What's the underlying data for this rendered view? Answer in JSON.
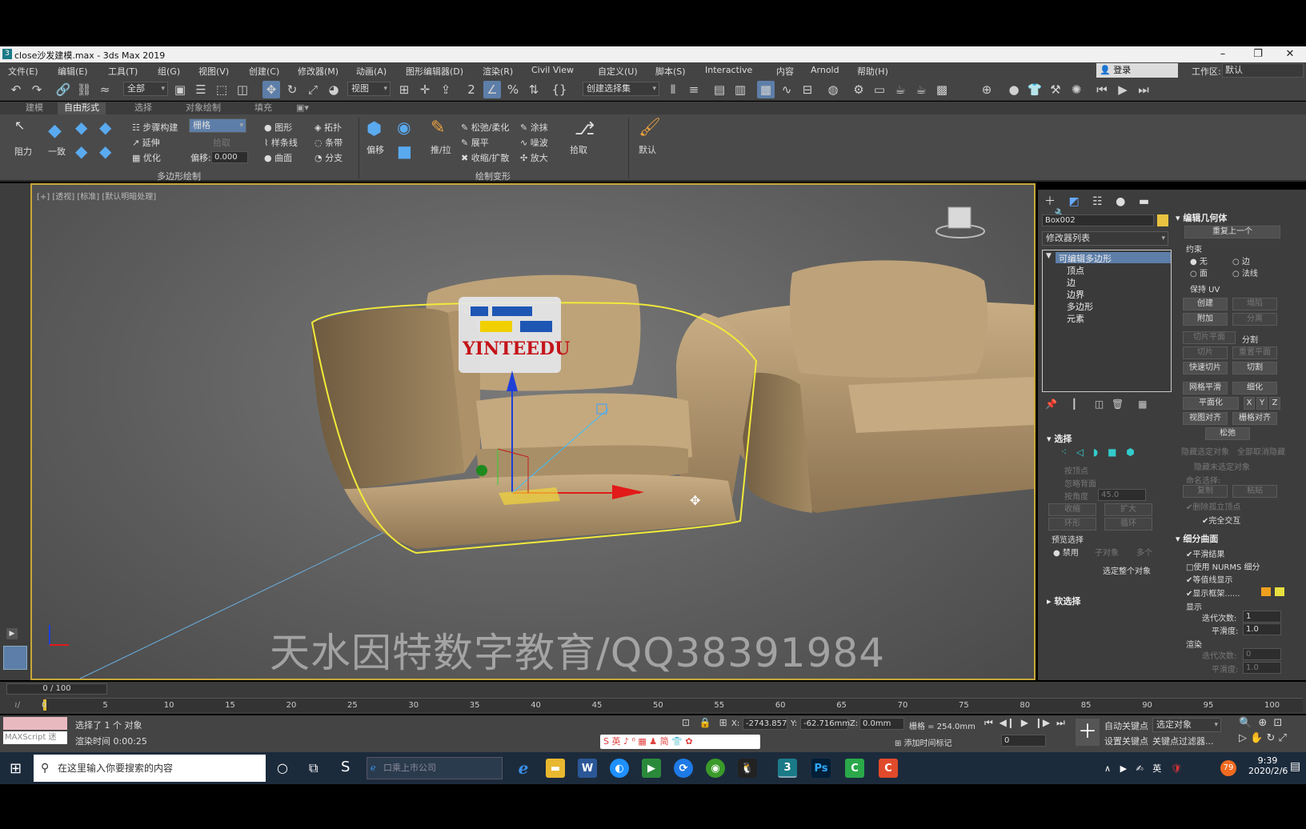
{
  "window": {
    "title": "close沙发建模.max - 3ds Max 2019",
    "app_logo": "3",
    "min": "–",
    "restore": "❐",
    "close": "✕"
  },
  "menu": {
    "items": [
      "文件(E)",
      "编辑(E)",
      "工具(T)",
      "组(G)",
      "视图(V)",
      "创建(C)",
      "修改器(M)",
      "动画(A)",
      "图形编辑器(D)",
      "渲染(R)",
      "Civil View",
      "自定义(U)",
      "脚本(S)",
      "Interactive",
      "内容",
      "Arnold",
      "帮助(H)"
    ],
    "login": "登录",
    "workspace_label": "工作区:",
    "workspace_value": "默认"
  },
  "toolbar": {
    "filter": "全部",
    "view_ref": "视图",
    "selection_set": "创建选择集"
  },
  "ribbon": {
    "tabs": [
      "建模",
      "自由形式",
      "选择",
      "对象绘制",
      "填充"
    ],
    "active_tab": "自由形式",
    "groups": {
      "poly_draw": "多边形绘制",
      "paint_deform": "绘制变形"
    },
    "labels": {
      "drag": "阻力",
      "conform": "一致",
      "step_build": "步骤构建",
      "extend": "延伸",
      "optimize": "优化",
      "grid_dd": "栅格",
      "pick": "拾取",
      "offset_label": "偏移:",
      "offset_value": "0.000",
      "shapes": "图形",
      "splines": "样条线",
      "surface": "曲面",
      "topology": "拓扑",
      "strips": "条带",
      "branches": "分支",
      "shift": "偏移",
      "push_pull": "推/拉",
      "relax_soft": "松弛/柔化",
      "flatten": "展平",
      "pinch_spread": "收缩/扩散",
      "smudge": "涂抹",
      "noise": "噪波",
      "exaggerate": "放大",
      "pickup": "拾取",
      "default": "默认"
    }
  },
  "viewport": {
    "label": "[+] [透视] [标准] [默认明暗处理]",
    "logo_text": "YINTEEDU",
    "watermark": "天水因特数字教育/QQ38391984"
  },
  "command_panel": {
    "object_name": "Box002",
    "object_color": "#e8c240",
    "modifier_list": "修改器列表",
    "stack": [
      "可编辑多边形",
      "顶点",
      "边",
      "边界",
      "多边形",
      "元素"
    ],
    "selection": {
      "title": "选择",
      "by_vertex": "按顶点",
      "ignore_back": "忽略背面",
      "by_angle": "按角度",
      "angle_value": "45.0",
      "shrink": "收缩",
      "grow": "扩大",
      "ring": "环形",
      "loop": "循环",
      "preview": "预览选择",
      "disable": "禁用",
      "subobj": "子对象",
      "multi": "多个",
      "whole_object": "选定整个对象"
    },
    "soft_sel": "软选择",
    "edit_geometry": {
      "title": "编辑几何体",
      "repeat_last": "重复上一个",
      "constraints": "约束",
      "none": "无",
      "edge": "边",
      "face": "面",
      "normal": "法线",
      "preserve_uv": "保持 UV",
      "create": "创建",
      "collapse": "塌陷",
      "attach": "附加",
      "detach": "分离",
      "slice_plane": "切片平面",
      "split": "分割",
      "slice": "切片",
      "reset_plane": "重置平面",
      "quickslice": "快速切片",
      "cut": "切割",
      "meshsmooth": "网格平滑",
      "tessellate": "细化",
      "planarize": "平面化",
      "x": "X",
      "y": "Y",
      "z": "Z",
      "view_align": "视图对齐",
      "grid_align": "栅格对齐",
      "relax": "松弛",
      "hide_sel": "隐藏选定对象",
      "unhide_all": "全部取消隐藏",
      "hide_unsel": "隐藏未选定对象",
      "named_sel": "命名选择:",
      "copy": "复制",
      "paste": "粘贴",
      "delete_iso": "删除孤立顶点",
      "full_interactive": "完全交互"
    },
    "subdivision": {
      "title": "细分曲面",
      "smooth_result": "平滑结果",
      "use_nurms": "使用 NURMS 细分",
      "isoline": "等值线显示",
      "show_cage": "显示框架......",
      "display": "显示",
      "iterations": "迭代次数:",
      "iter_value": "1",
      "smoothness": "平滑度:",
      "smooth_value": "1.0",
      "render": "渲染",
      "r_iter": "0",
      "r_smooth": "1.0"
    }
  },
  "timeline": {
    "frame": "0 / 100",
    "ticks": [
      "0",
      "5",
      "10",
      "15",
      "20",
      "25",
      "30",
      "35",
      "40",
      "45",
      "50",
      "55",
      "60",
      "65",
      "70",
      "75",
      "80",
      "85",
      "90",
      "95",
      "100"
    ]
  },
  "status": {
    "maxscript": "MAXScript 迷",
    "selected": "选择了 1 个 对象",
    "render_time": "渲染时间  0:00:25",
    "x_label": "X:",
    "x": "-2743.857",
    "y_label": "Y:",
    "y": "-62.716mm",
    "z_label": "Z:",
    "z": "0.0mm",
    "grid": "栅格 = 254.0mm",
    "add_time_tag": "添加时间标记",
    "auto_key": "自动关键点",
    "set_key": "设置关键点",
    "selected_obj": "选定对象",
    "key_filters": "关键点过滤器...",
    "frame_value": "0"
  },
  "taskbar": {
    "search_placeholder": "在这里输入你要搜索的内容",
    "browser_field": "口乘上市公司",
    "ime": "英",
    "time": "9:39",
    "date": "2020/2/6",
    "badge": "79"
  }
}
